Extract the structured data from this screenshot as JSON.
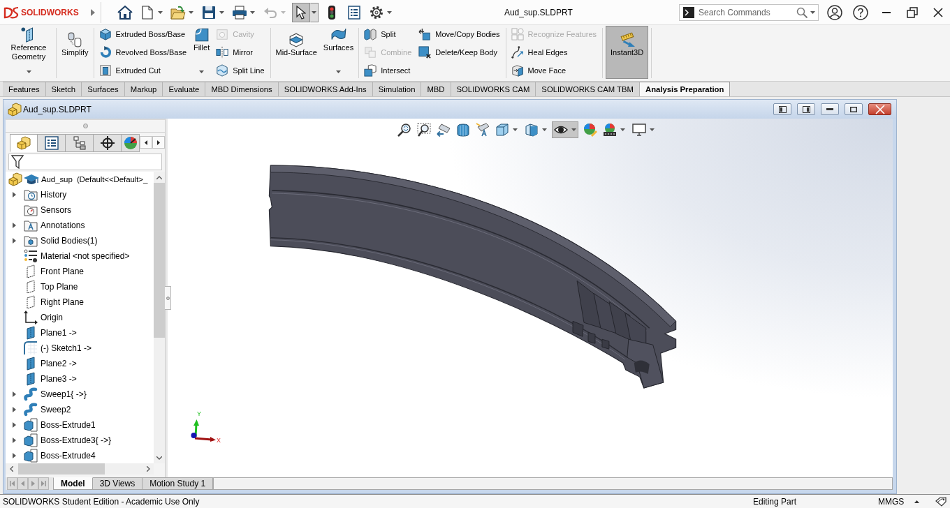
{
  "title_bar": {
    "logo": "SOLIDWORKS",
    "quick_access": [
      {
        "dropdown": false,
        "disabled": false,
        "selected": false
      },
      {
        "dropdown": true,
        "disabled": false,
        "selected": false
      },
      {
        "dropdown": true,
        "disabled": false,
        "selected": false
      },
      {
        "dropdown": true,
        "disabled": false,
        "selected": false
      },
      {
        "dropdown": true,
        "disabled": false,
        "selected": false
      },
      {
        "dropdown": true,
        "disabled": true,
        "selected": false
      },
      {
        "dropdown": true,
        "disabled": false,
        "selected": true
      },
      {
        "dropdown": false,
        "disabled": false,
        "selected": false
      },
      {
        "dropdown": false,
        "disabled": false,
        "selected": false
      },
      {
        "dropdown": true,
        "disabled": false,
        "selected": false
      }
    ],
    "document_title": "Aud_sup.SLDPRT",
    "search": {
      "placeholder": "Search Commands"
    }
  },
  "ribbon": {
    "groups": [
      {
        "columns": [
          {
            "kind": "large",
            "dropdown": true,
            "buttons": [
              {
                "label": "Reference Geometry",
                "disabled": false,
                "on": false
              }
            ]
          }
        ]
      },
      {
        "columns": [
          {
            "kind": "large",
            "dropdown": false,
            "buttons": [
              {
                "label": "Simplify",
                "disabled": false,
                "on": false
              }
            ]
          }
        ]
      },
      {
        "columns": [
          {
            "kind": "small",
            "dropdown": false,
            "buttons": [
              {
                "label": "Extruded Boss/Base",
                "disabled": false,
                "on": false
              },
              {
                "label": "Revolved Boss/Base",
                "disabled": false,
                "on": false
              },
              {
                "label": "Extruded Cut",
                "disabled": false,
                "on": false
              }
            ]
          },
          {
            "kind": "large",
            "dropdown": true,
            "buttons": [
              {
                "label": "Fillet",
                "disabled": false,
                "on": false
              }
            ]
          },
          {
            "kind": "small",
            "dropdown": false,
            "buttons": [
              {
                "label": "Cavity",
                "disabled": true,
                "on": false
              },
              {
                "label": "Mirror",
                "disabled": false,
                "on": false
              },
              {
                "label": "Split Line",
                "disabled": false,
                "on": false
              }
            ]
          }
        ]
      },
      {
        "columns": [
          {
            "kind": "large",
            "dropdown": false,
            "buttons": [
              {
                "label": "Mid-Surface",
                "disabled": false,
                "on": false
              }
            ]
          },
          {
            "kind": "large",
            "dropdown": true,
            "buttons": [
              {
                "label": "Surfaces",
                "disabled": false,
                "on": false
              }
            ]
          }
        ]
      },
      {
        "columns": [
          {
            "kind": "small",
            "dropdown": false,
            "buttons": [
              {
                "label": "Split",
                "disabled": false,
                "on": false
              },
              {
                "label": "Combine",
                "disabled": true,
                "on": false
              },
              {
                "label": "Intersect",
                "disabled": false,
                "on": false
              }
            ]
          },
          {
            "kind": "small",
            "dropdown": false,
            "buttons": [
              {
                "label": "Move/Copy Bodies",
                "disabled": false,
                "on": false
              },
              {
                "label": "Delete/Keep Body",
                "disabled": false,
                "on": false
              }
            ]
          }
        ]
      },
      {
        "columns": [
          {
            "kind": "small",
            "dropdown": false,
            "buttons": [
              {
                "label": "Recognize Features",
                "disabled": true,
                "on": false
              },
              {
                "label": "Heal Edges",
                "disabled": false,
                "on": false
              },
              {
                "label": "Move Face",
                "disabled": false,
                "on": false
              }
            ]
          }
        ]
      },
      {
        "columns": [
          {
            "kind": "large",
            "dropdown": false,
            "buttons": [
              {
                "label": "Instant3D",
                "disabled": false,
                "on": true
              }
            ]
          }
        ]
      }
    ]
  },
  "command_tabs": [
    {
      "label": "Features",
      "selected": false
    },
    {
      "label": "Sketch",
      "selected": false
    },
    {
      "label": "Surfaces",
      "selected": false
    },
    {
      "label": "Markup",
      "selected": false
    },
    {
      "label": "Evaluate",
      "selected": false
    },
    {
      "label": "MBD Dimensions",
      "selected": false
    },
    {
      "label": "SOLIDWORKS Add-Ins",
      "selected": false
    },
    {
      "label": "Simulation",
      "selected": false
    },
    {
      "label": "MBD",
      "selected": false
    },
    {
      "label": "SOLIDWORKS CAM",
      "selected": false
    },
    {
      "label": "SOLIDWORKS CAM TBM",
      "selected": false
    },
    {
      "label": "Analysis Preparation",
      "selected": true
    }
  ],
  "document_window": {
    "title": "Aud_sup.SLDPRT",
    "feature_manager": {
      "tabs": [
        {
          "selected": true
        },
        {
          "selected": false
        },
        {
          "selected": false
        },
        {
          "selected": false
        },
        {
          "selected": false
        }
      ],
      "root_label": "Aud_sup  (Default<<Default>_",
      "items": [
        {
          "label": "History",
          "expandable": true
        },
        {
          "label": "Sensors",
          "expandable": false
        },
        {
          "label": "Annotations",
          "expandable": true
        },
        {
          "label": "Solid Bodies(1)",
          "expandable": true
        },
        {
          "label": "Material <not specified>",
          "expandable": false
        },
        {
          "label": "Front Plane",
          "expandable": false
        },
        {
          "label": "Top Plane",
          "expandable": false
        },
        {
          "label": "Right Plane",
          "expandable": false
        },
        {
          "label": "Origin",
          "expandable": false
        },
        {
          "label": "Plane1 ->",
          "expandable": false
        },
        {
          "label": "(-) Sketch1 ->",
          "expandable": false
        },
        {
          "label": "Plane2 ->",
          "expandable": false
        },
        {
          "label": "Plane3 ->",
          "expandable": false
        },
        {
          "label": "Sweep1{ ->}",
          "expandable": true
        },
        {
          "label": "Sweep2",
          "expandable": true
        },
        {
          "label": "Boss-Extrude1",
          "expandable": true
        },
        {
          "label": "Boss-Extrude3{ ->}",
          "expandable": true
        },
        {
          "label": "Boss-Extrude4",
          "expandable": true
        }
      ]
    },
    "view_toolbar": [
      {
        "dropdown": false,
        "selected": false
      },
      {
        "dropdown": false,
        "selected": false
      },
      {
        "dropdown": false,
        "selected": false
      },
      {
        "dropdown": false,
        "selected": false
      },
      {
        "dropdown": false,
        "selected": false
      },
      {
        "dropdown": true,
        "selected": false
      },
      {
        "dropdown": true,
        "selected": false
      },
      {
        "dropdown": true,
        "selected": true
      },
      {
        "dropdown": false,
        "selected": false
      },
      {
        "dropdown": true,
        "selected": false
      },
      {
        "dropdown": true,
        "selected": false
      }
    ],
    "triad": {
      "x_label": "X",
      "y_label": "Y"
    },
    "bottom_tabs": [
      {
        "label": "Model",
        "selected": true
      },
      {
        "label": "3D Views",
        "selected": false
      },
      {
        "label": "Motion Study 1",
        "selected": false
      }
    ]
  },
  "status_bar": {
    "message": "SOLIDWORKS Student Edition - Academic Use Only",
    "mode": "Editing Part",
    "units": "MMGS"
  }
}
